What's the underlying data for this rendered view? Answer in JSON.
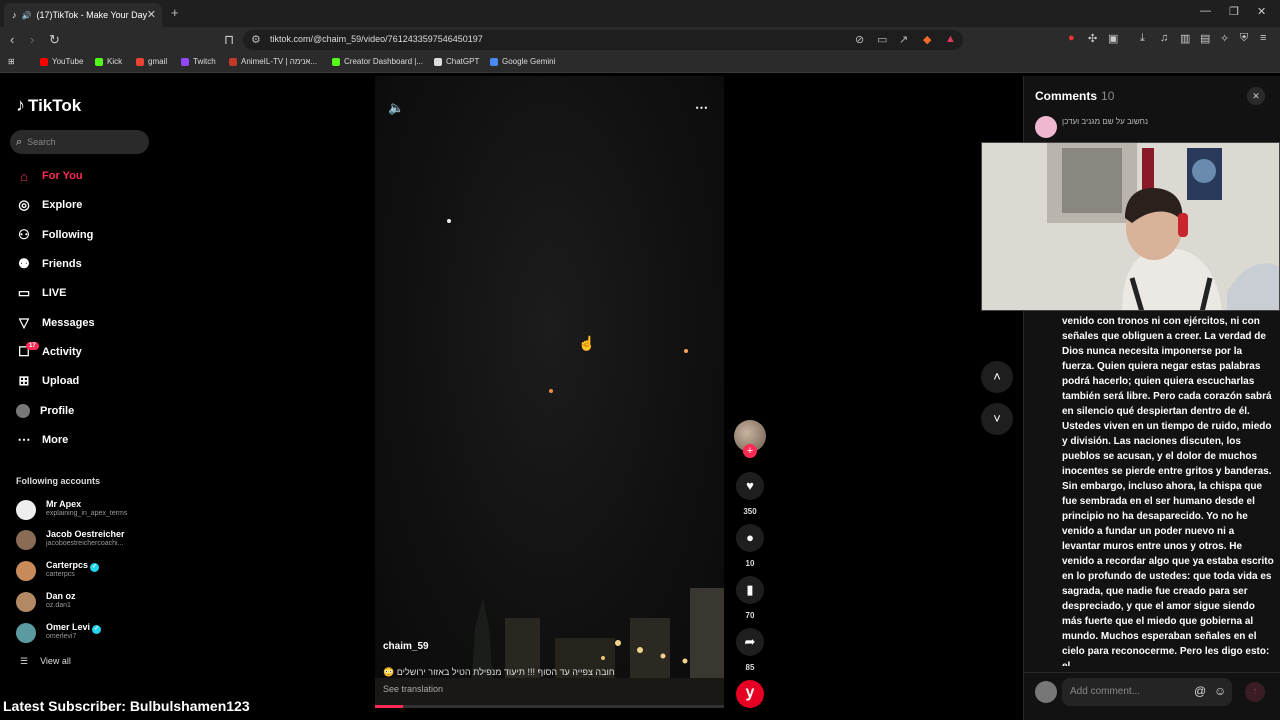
{
  "browser": {
    "tab_title": "(17)TikTok - Make Your Day",
    "url": "tiktok.com/@chaim_59/video/7612433597546450197",
    "bookmarks": [
      "YouTube",
      "Kick",
      "gmail",
      "Twitch",
      "AnimeIL-TV | אנימה...",
      "Creator Dashboard |...",
      "ChatGPT",
      "Google Gemini"
    ]
  },
  "sidebar": {
    "logo": "TikTok",
    "search_placeholder": "Search",
    "nav": [
      "For You",
      "Explore",
      "Following",
      "Friends",
      "LIVE",
      "Messages",
      "Activity",
      "Upload",
      "Profile",
      "More"
    ],
    "activity_badge": "17",
    "following_title": "Following accounts",
    "accounts": [
      {
        "name": "Mr Apex",
        "handle": "explaining_in_apex_terms",
        "verified": false
      },
      {
        "name": "Jacob Oestreicher",
        "handle": "jacoboestreichercoachi...",
        "verified": false
      },
      {
        "name": "Carterpcs",
        "handle": "carterpcs",
        "verified": true
      },
      {
        "name": "Dan oz",
        "handle": "oz.dan1",
        "verified": false
      },
      {
        "name": "Omer Levi",
        "handle": "omerlevi7",
        "verified": true
      }
    ],
    "view_all": "View all"
  },
  "overlay": {
    "subscriber": "Latest Subscriber: Bulbulshamen123"
  },
  "video": {
    "author": "chaim_59",
    "caption": "חובה צפייה עד הסוף !!! תיעוד מנפילת הטיל באזור ירושלים 😳",
    "see_translation": "See translation",
    "progress": 0.08
  },
  "actions": {
    "likes": "350",
    "comments": "10",
    "saves": "70",
    "shares": "85",
    "y_label": "y"
  },
  "comments": {
    "title": "Comments",
    "count": "10",
    "first_author": "נחשוב על שם מגניב ועדכן",
    "body": "venido con tronos ni con ejércitos, ni con señales que obliguen a creer. La verdad de Dios nunca necesita imponerse por la fuerza. Quien quiera negar estas palabras podrá hacerlo; quien quiera escucharlas también será libre. Pero cada corazón sabrá en silencio qué despiertan dentro de él. Ustedes viven en un tiempo de ruido, miedo y división. Las naciones discuten, los pueblos se acusan, y el dolor de muchos inocentes se pierde entre gritos y banderas. Sin embargo, incluso ahora, la chispa que fue sembrada en el ser humano desde el principio no ha desaparecido. Yo no he venido a fundar un poder nuevo ni a levantar muros entre unos y otros. He venido a recordar algo que ya estaba escrito en lo profundo de ustedes: que toda vida es sagrada, que nadie fue creado para ser despreciado, y que el amor sigue siendo más fuerte que el miedo que gobierna al mundo. Muchos esperaban señales en el cielo para reconocerme. Pero les digo esto: el",
    "input_placeholder": "Add comment..."
  },
  "colors": {
    "accent": "#fe2c55",
    "verified": "#20d5ec"
  }
}
